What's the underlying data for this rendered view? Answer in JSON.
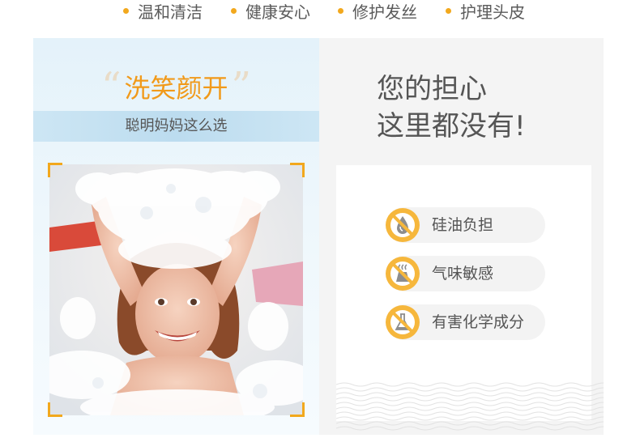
{
  "features": [
    "温和清洁",
    "健康安心",
    "修护发丝",
    "护理头皮"
  ],
  "left_panel": {
    "headline": "洗笑颜开",
    "open_quote": "“",
    "close_quote": "”",
    "subline": "聪明妈妈这么选"
  },
  "right_panel": {
    "title_line1": "您的担心",
    "title_line2": "这里都没有!",
    "concerns": [
      {
        "label": "硅油负担",
        "icon": "no-silicone-oil-icon"
      },
      {
        "label": "气味敏感",
        "icon": "no-odor-icon"
      },
      {
        "label": "有害化学成分",
        "icon": "no-chemicals-icon"
      }
    ]
  },
  "colors": {
    "accent": "#f2a81d",
    "headline": "#f19a1a",
    "icon_fill": "#f6b73c",
    "panel_blue": "#bcdcef"
  }
}
